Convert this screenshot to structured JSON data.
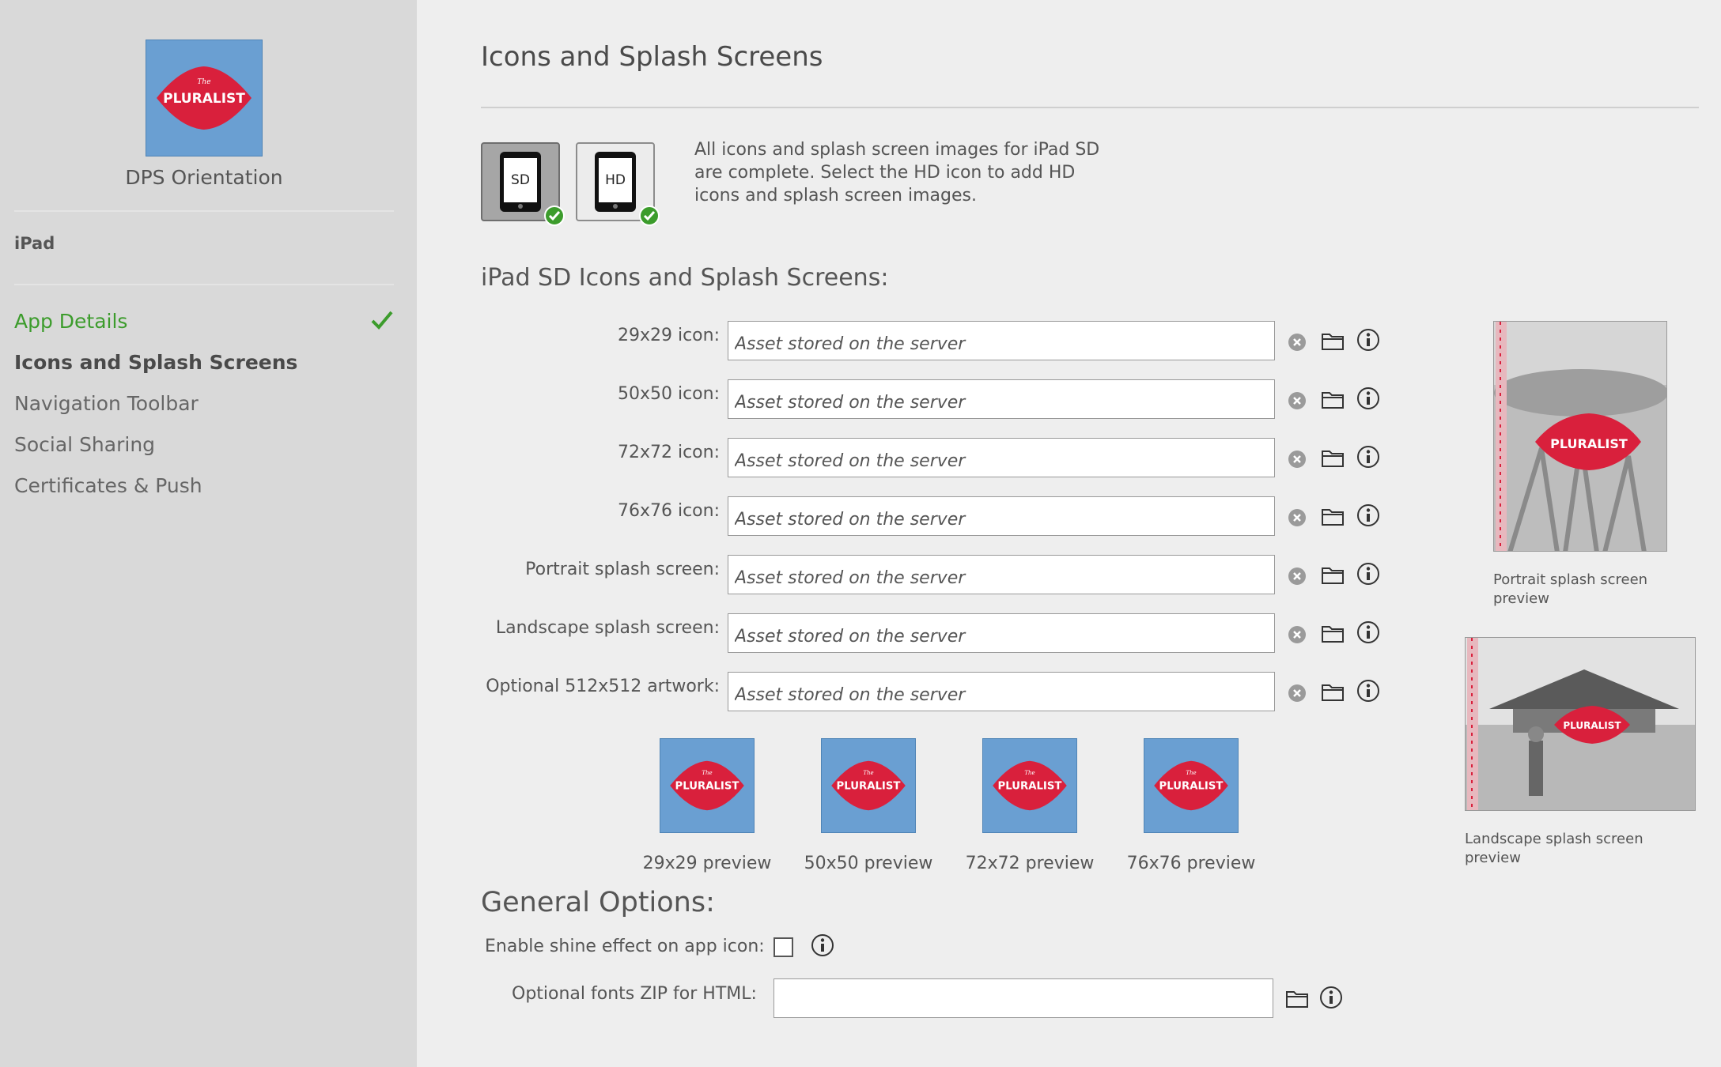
{
  "sidebar": {
    "app_name": "DPS Orientation",
    "logo_text": "PLURALIST",
    "logo_small_text": "The",
    "device": "iPad",
    "items": [
      {
        "label": "App Details",
        "state": "done"
      },
      {
        "label": "Icons and Splash Screens",
        "state": "active"
      },
      {
        "label": "Navigation Toolbar",
        "state": "normal"
      },
      {
        "label": "Social Sharing",
        "state": "normal"
      },
      {
        "label": "Certificates & Push",
        "state": "normal"
      }
    ]
  },
  "main": {
    "title": "Icons and Splash Screens",
    "device_buttons": [
      {
        "label": "SD",
        "selected": true,
        "complete": true
      },
      {
        "label": "HD",
        "selected": false,
        "complete": true
      }
    ],
    "complete_message": "All icons and splash screen images for iPad SD are complete. Select the HD icon to add HD icons and splash screen images.",
    "section_heading": "iPad SD Icons and Splash Screens:",
    "asset_rows": [
      {
        "label": "29x29 icon:",
        "value": "Asset stored on the server"
      },
      {
        "label": "50x50 icon:",
        "value": "Asset stored on the server"
      },
      {
        "label": "72x72 icon:",
        "value": "Asset stored on the server"
      },
      {
        "label": "76x76 icon:",
        "value": "Asset stored on the server"
      },
      {
        "label": "Portrait splash screen:",
        "value": "Asset stored on the server"
      },
      {
        "label": "Landscape splash screen:",
        "value": "Asset stored on the server"
      },
      {
        "label": "Optional 512x512 artwork:",
        "value": "Asset stored on the server"
      }
    ],
    "icon_previews": [
      {
        "label": "29x29 preview"
      },
      {
        "label": "50x50 preview"
      },
      {
        "label": "72x72 preview"
      },
      {
        "label": "76x76 preview"
      }
    ],
    "portrait_preview_label": "Portrait splash screen preview",
    "landscape_preview_label": "Landscape splash screen preview"
  },
  "general": {
    "heading": "General Options:",
    "shine_label": "Enable shine effect on app icon:",
    "shine_checked": false,
    "fonts_label": "Optional fonts ZIP for HTML:",
    "fonts_value": ""
  },
  "colors": {
    "sidebar_bg": "#d9d9d9",
    "main_bg": "#eeeeee",
    "done_green": "#3c9c2c",
    "logo_blue": "#6a9fd2",
    "logo_red": "#d9203c"
  },
  "icons": {
    "clear": "x-circle-icon",
    "browse": "folder-icon",
    "info": "info-icon",
    "check": "checkmark-icon"
  }
}
